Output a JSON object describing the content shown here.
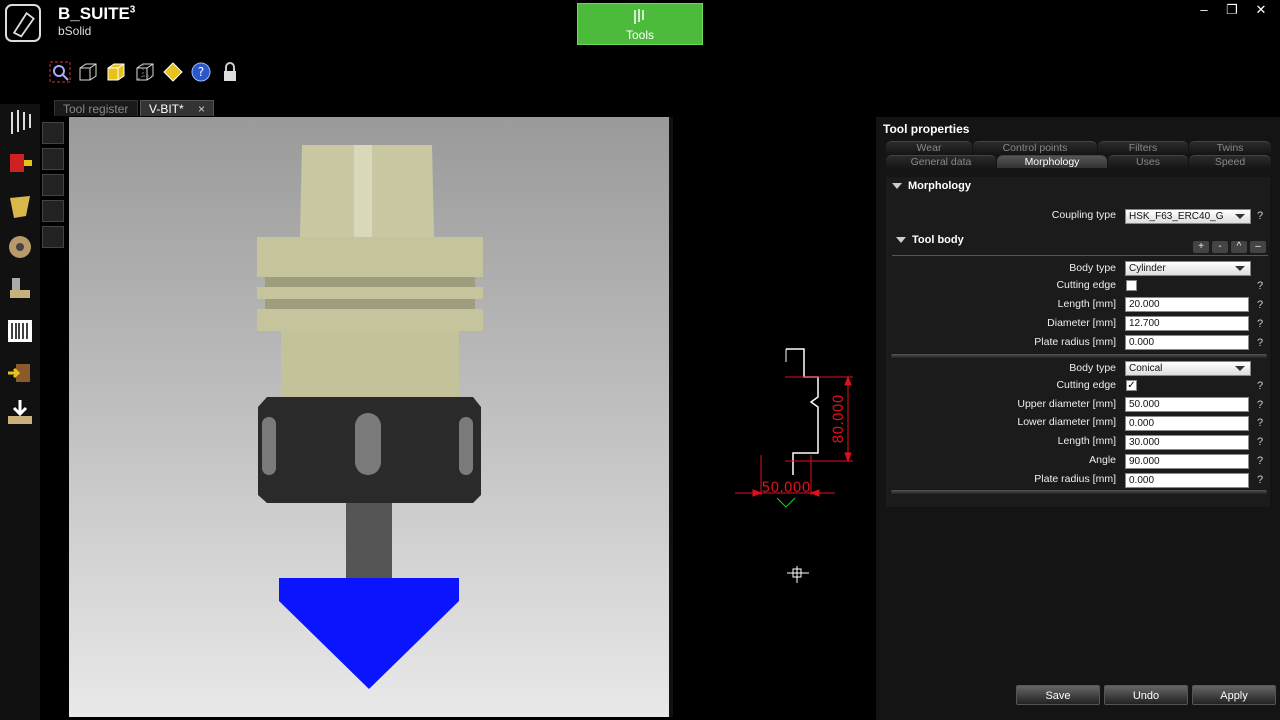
{
  "app": {
    "title": "B_SUITE",
    "title_sup": "3",
    "subtitle": "bSolid"
  },
  "ribbon": {
    "tools_label": "Tools"
  },
  "window": {
    "minimize": "‒",
    "restore": "❐",
    "close": "✕"
  },
  "doc_tabs": [
    {
      "label": "Tool register"
    },
    {
      "label": "V-BIT*",
      "close": "×"
    }
  ],
  "drawing": {
    "height_dim": "80.000",
    "width_dim": "50.000"
  },
  "panel": {
    "title": "Tool properties",
    "tabs_row1": [
      "Wear",
      "Control points",
      "Filters",
      "Twins"
    ],
    "tabs_row2": [
      "General data",
      "Morphology",
      "Uses",
      "Speed"
    ],
    "selected_tab": "Morphology",
    "morphology": {
      "header": "Morphology",
      "coupling_label": "Coupling type",
      "coupling_value": "HSK_F63_ERC40_G"
    },
    "tool_body": {
      "header": "Tool body",
      "buttons": [
        "+",
        "-",
        "^",
        "–"
      ],
      "body1": {
        "type_label": "Body type",
        "type_value": "Cylinder",
        "edge_label": "Cutting edge",
        "edge_checked": "",
        "length_label": "Length [mm]",
        "length_value": "20.000",
        "diameter_label": "Diameter [mm]",
        "diameter_value": "12.700",
        "radius_label": "Plate radius [mm]",
        "radius_value": "0.000"
      },
      "body2": {
        "type_label": "Body type",
        "type_value": "Conical",
        "edge_label": "Cutting edge",
        "edge_checked": "✓",
        "upper_label": "Upper diameter [mm]",
        "upper_value": "50.000",
        "lower_label": "Lower diameter [mm]",
        "lower_value": "0.000",
        "length_label": "Length [mm]",
        "length_value": "30.000",
        "angle_label": "Angle",
        "angle_value": "90.000",
        "radius_label": "Plate radius [mm]",
        "radius_value": "0.000"
      }
    },
    "help": "?",
    "actions": {
      "save": "Save",
      "undo": "Undo",
      "apply": "Apply"
    }
  },
  "colors": {
    "accent_green": "#4cbb3c",
    "holder": "#c9c8a2",
    "nut": "#2a2a2a",
    "bit": "#0a14ff",
    "dim_red": "#e0101a"
  }
}
